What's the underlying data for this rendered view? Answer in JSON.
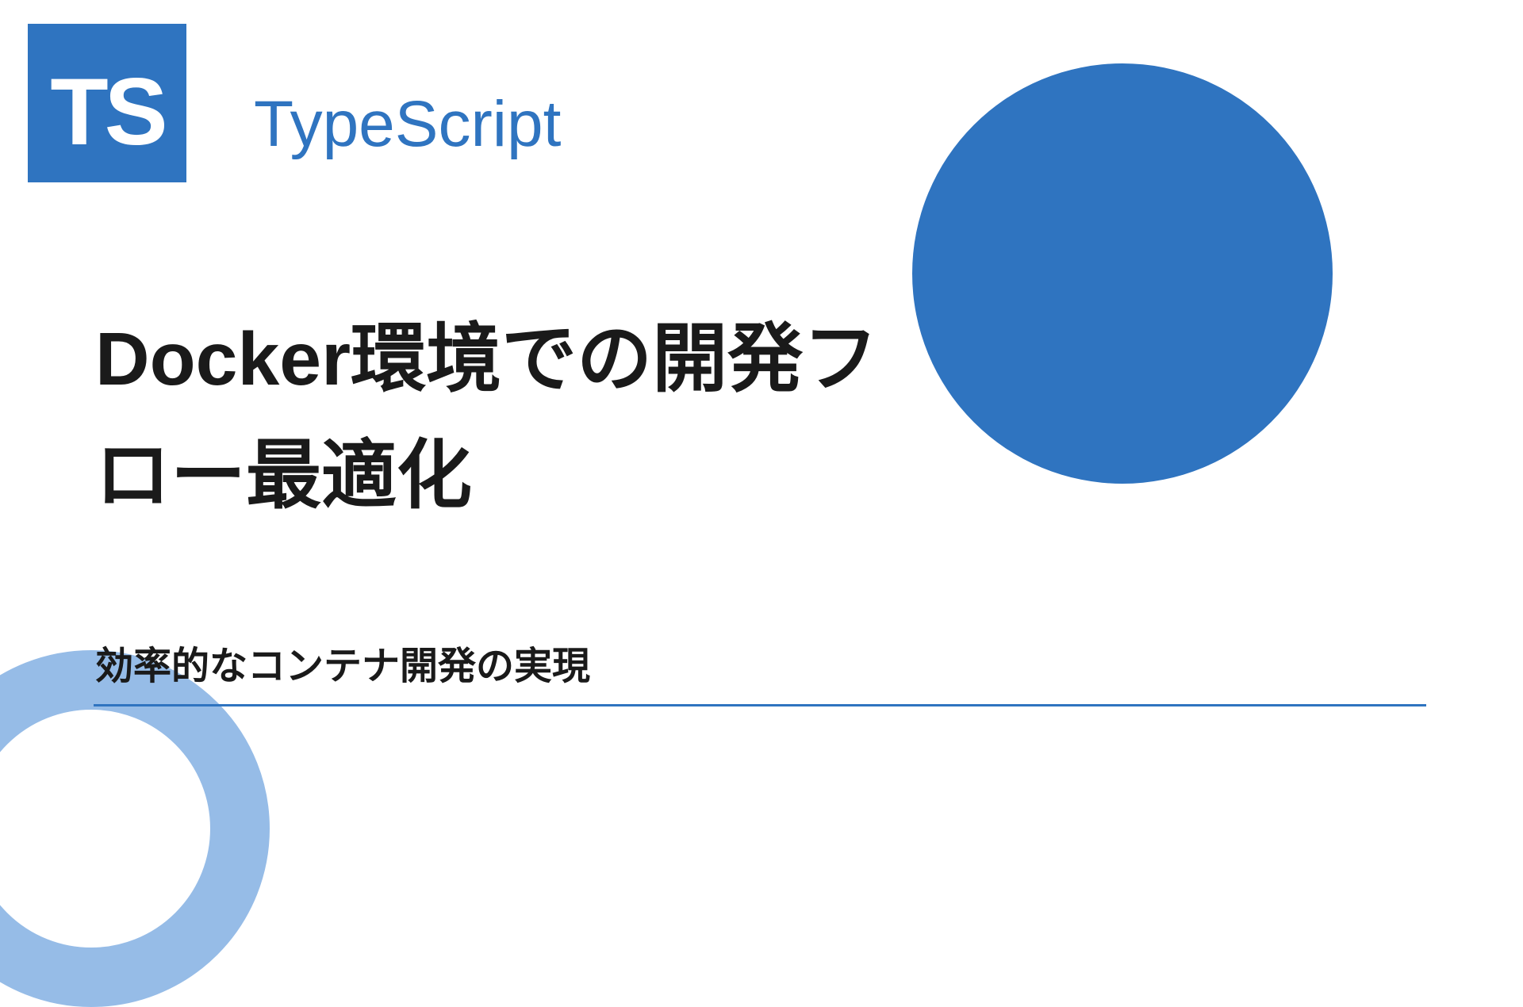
{
  "logo": {
    "text": "TS"
  },
  "brand": {
    "title": "TypeScript"
  },
  "main": {
    "title": "Docker環境での開発フロー最適化",
    "subtitle": "効率的なコンテナ開発の実現"
  },
  "colors": {
    "primary": "#2f74c0",
    "light": "#96bce7"
  }
}
